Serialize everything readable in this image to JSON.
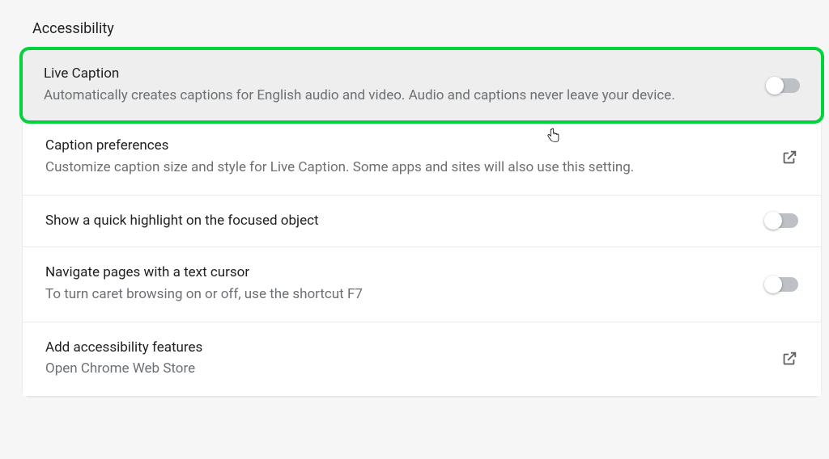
{
  "section_title": "Accessibility",
  "rows": {
    "live_caption": {
      "title": "Live Caption",
      "desc": "Automatically creates captions for English audio and video. Audio and captions never leave your device.",
      "toggle_on": false
    },
    "caption_prefs": {
      "title": "Caption preferences",
      "desc": "Customize caption size and style for Live Caption. Some apps and sites will also use this setting."
    },
    "quick_highlight": {
      "title": "Show a quick highlight on the focused object",
      "toggle_on": false
    },
    "text_cursor": {
      "title": "Navigate pages with a text cursor",
      "desc": "To turn caret browsing on or off, use the shortcut F7",
      "toggle_on": false
    },
    "add_features": {
      "title": "Add accessibility features",
      "desc": "Open Chrome Web Store"
    }
  }
}
